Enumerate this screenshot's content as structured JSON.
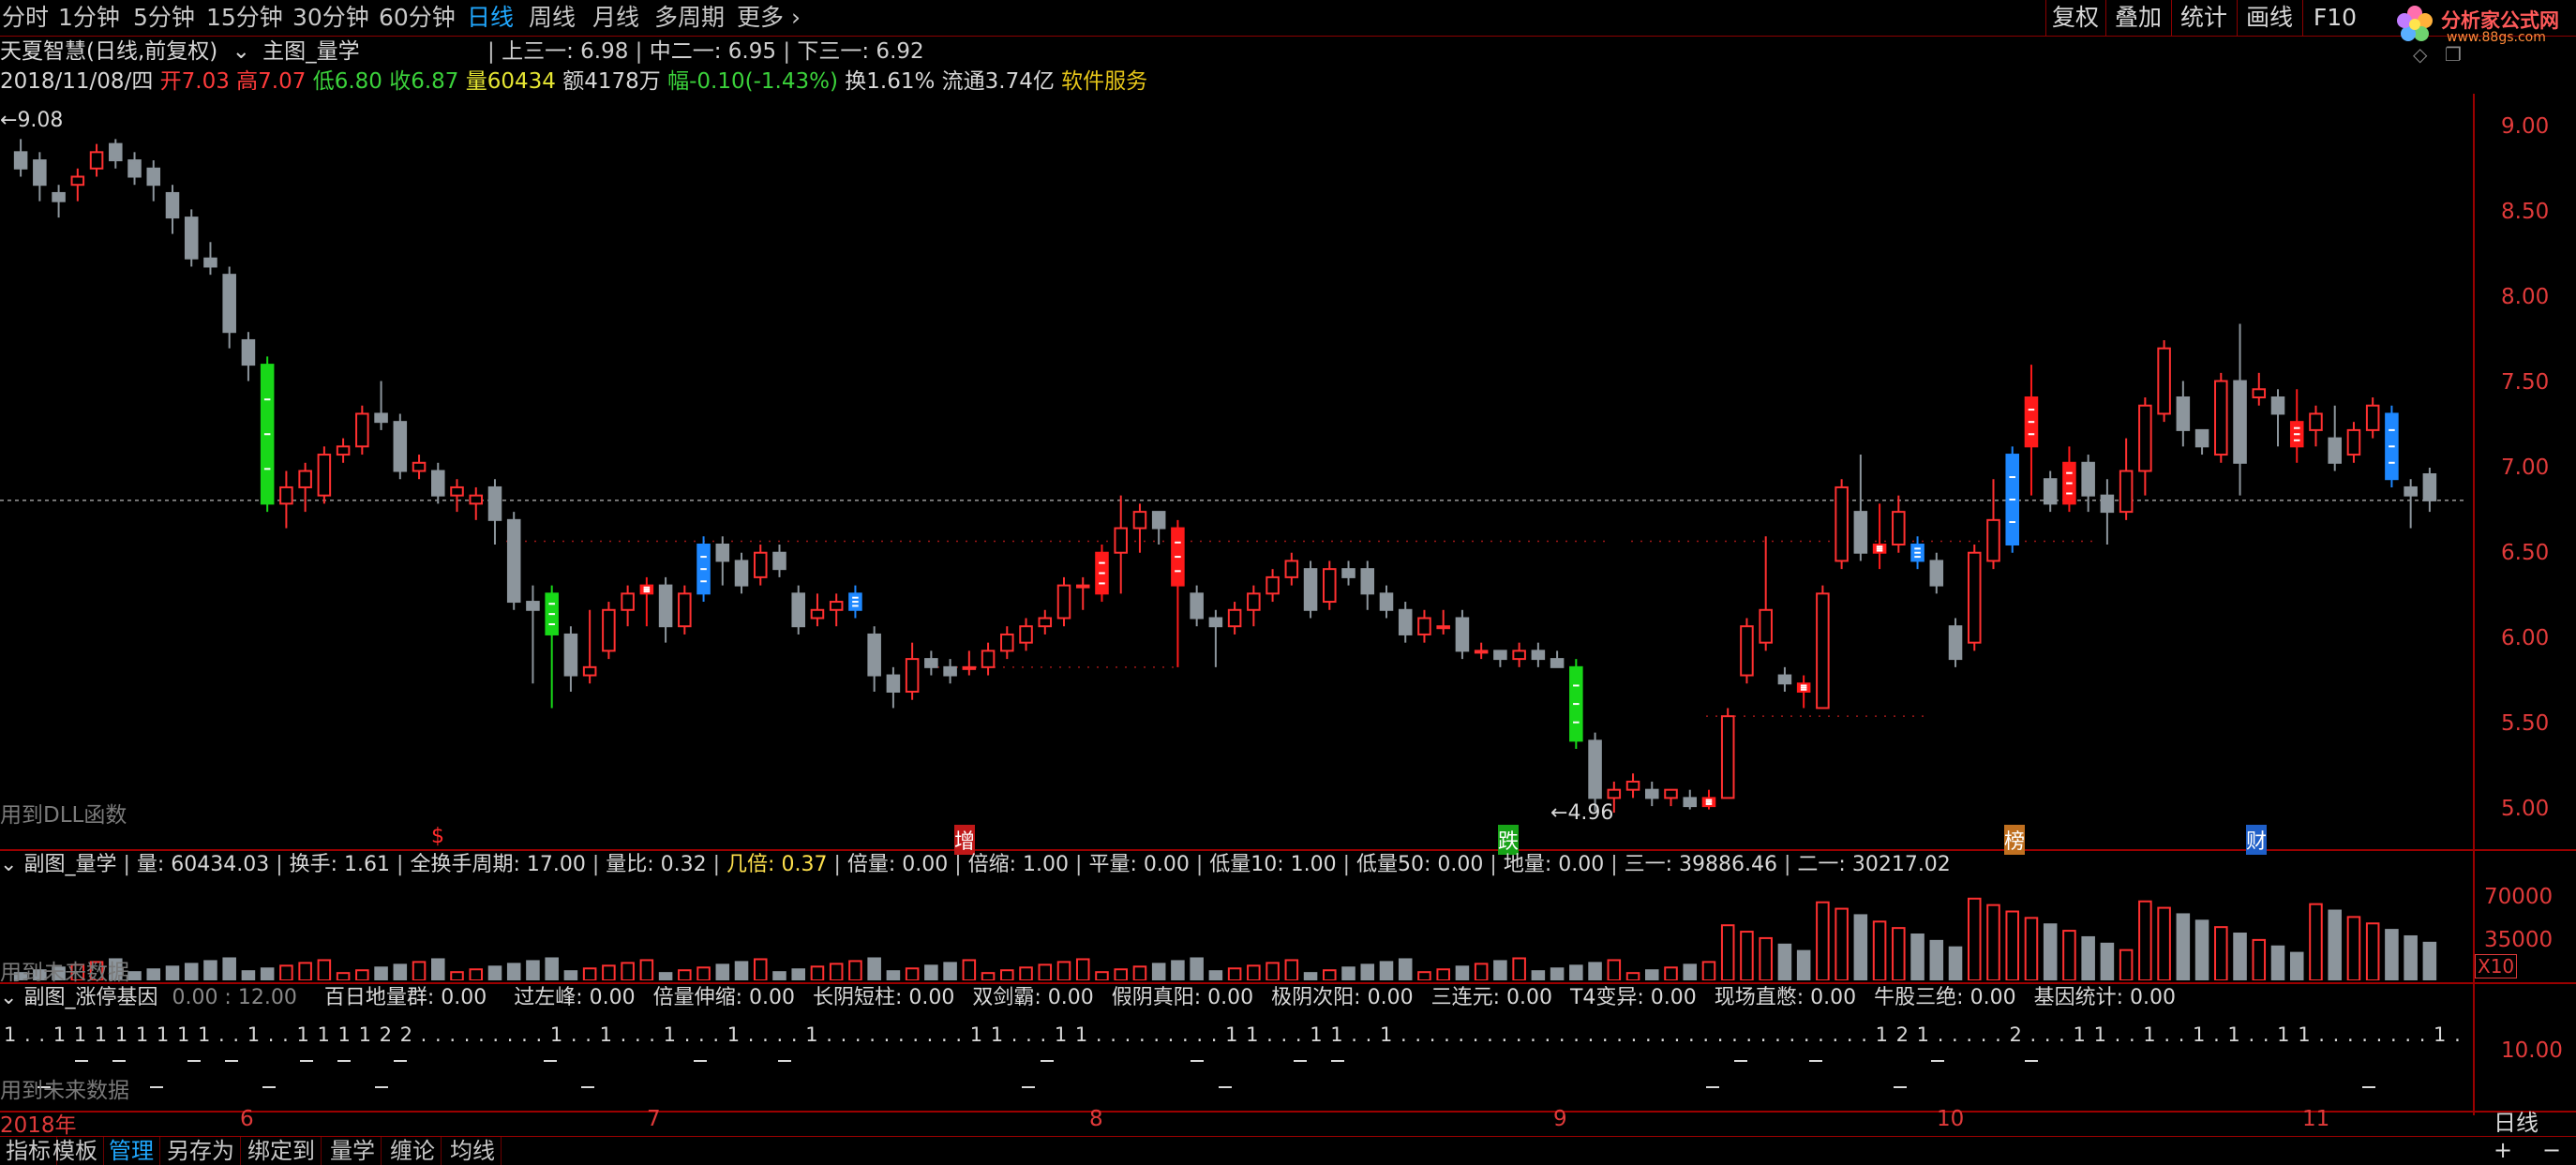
{
  "period_tabs": [
    "分时",
    "1分钟",
    "5分钟",
    "15分钟",
    "30分钟",
    "60分钟",
    "日线",
    "周线",
    "月线",
    "多周期",
    "更多"
  ],
  "active_period": "日线",
  "right_tools": [
    "复权",
    "叠加",
    "统计",
    "画线",
    "F10"
  ],
  "logo": {
    "name": "分析家公式网",
    "url_text": "www.88gs.com"
  },
  "title_row": {
    "stock": "天夏智慧(日线,前复权)",
    "main_indicator": "主图_量学",
    "upper": "上三一: 6.98",
    "middle": "中二一: 6.95",
    "lower": "下三一: 6.92"
  },
  "quote_row": {
    "date": "2018/11/08/四",
    "open_label": "开",
    "open": "7.03",
    "high_label": "高",
    "high": "7.07",
    "low_label": "低",
    "low": "6.80",
    "close_label": "收",
    "close": "6.87",
    "vol_label": "量",
    "vol": "60434",
    "amount": "额4178万",
    "change_label": "幅",
    "change": "-0.10(-1.43%)",
    "turnover": "换1.61%",
    "float_cap": "流通3.74亿",
    "service": "软件服务"
  },
  "main_chart": {
    "max_label": "9.08",
    "min_label": "4.96",
    "dll_note": "用到DLL函数",
    "yticks": [
      "9.00",
      "8.50",
      "8.00",
      "7.50",
      "7.00",
      "6.50",
      "6.00",
      "5.50",
      "5.00"
    ],
    "markers": [
      "$",
      "增",
      "跌",
      "榜",
      "财"
    ]
  },
  "sub1": {
    "title": "副图_量学",
    "fields": [
      "量: 60434.03",
      "换手: 1.61",
      "全换手周期: 17.00",
      "量比: 0.32",
      "几倍: 0.37",
      "倍量: 0.00",
      "倍缩: 1.00",
      "平量: 0.00",
      "低量10: 1.00",
      "低量50: 0.00",
      "地量: 0.00",
      "三一: 39886.46",
      "二一: 30217.02"
    ],
    "future_note": "用到未来数据",
    "yticks": [
      "70000",
      "35000"
    ],
    "unit": "X10"
  },
  "sub2": {
    "title": "副图_涨停基因",
    "values": "0.00 : 12.00",
    "fields": [
      "百日地量群: 0.00",
      "过左峰: 0.00",
      "倍量伸缩: 0.00",
      "长阴短柱: 0.00",
      "双剑霸: 0.00",
      "假阴真阳: 0.00",
      "极阴次阳: 0.00",
      "三连元: 0.00",
      "T4变异: 0.00",
      "现场直憋: 0.00",
      "牛股三绝: 0.00",
      "基因统计: 0.00"
    ],
    "future_note": "用到未来数据",
    "yticks": [
      "10.00"
    ],
    "row_text": "1 . . 1 1 1 1 1 1 1 1 . . 1 . . 1 1 1 1 2 2 . . . . . . . . . 1 . . 1 . . . 1 . . . 1 . . . . 1 . . . . . . . . . . 1 1 . . . 1 1 . . . . . . . . . 1 1 . . . 1 1 . . 1 . . . . . . . . . . . . . . . . . . . . . . . . . . . . . . . . . 1 2 1 . . . . . 2 . . . 1 1 . . 1 . . 1 . 1 . . 1 1 . . . . . . . . 1 . . 1 . . . . . . . . 1 1 . . . ."
  },
  "xaxis": [
    "2018年",
    "6",
    "7",
    "8",
    "9",
    "10",
    "11"
  ],
  "period_label": "日线",
  "bottom_tabs": [
    "指标",
    "模板",
    "管理",
    "另存为",
    "绑定到",
    "量学",
    "缠论",
    "均线"
  ],
  "active_bottom": "管理",
  "chart_data": {
    "type": "candlestick",
    "price_range": [
      4.8,
      9.3
    ],
    "reference_line": 6.87,
    "candles": [
      [
        9.0,
        8.9,
        9.08,
        8.85
      ],
      [
        8.95,
        8.8,
        9.0,
        8.7
      ],
      [
        8.75,
        8.7,
        8.8,
        8.6
      ],
      [
        8.8,
        8.85,
        8.9,
        8.7
      ],
      [
        8.9,
        9.0,
        9.05,
        8.85
      ],
      [
        9.05,
        8.95,
        9.08,
        8.9
      ],
      [
        8.95,
        8.85,
        9.0,
        8.8
      ],
      [
        8.9,
        8.8,
        8.95,
        8.7
      ],
      [
        8.75,
        8.6,
        8.8,
        8.5
      ],
      [
        8.6,
        8.35,
        8.65,
        8.3
      ],
      [
        8.35,
        8.3,
        8.45,
        8.25
      ],
      [
        8.25,
        7.9,
        8.3,
        7.8
      ],
      [
        7.85,
        7.7,
        7.9,
        7.6
      ],
      [
        7.7,
        6.85,
        7.75,
        6.8
      ],
      [
        6.85,
        6.95,
        7.05,
        6.7
      ],
      [
        6.95,
        7.05,
        7.1,
        6.8
      ],
      [
        6.9,
        7.15,
        7.2,
        6.85
      ],
      [
        7.15,
        7.2,
        7.25,
        7.1
      ],
      [
        7.2,
        7.4,
        7.45,
        7.15
      ],
      [
        7.4,
        7.35,
        7.6,
        7.3
      ],
      [
        7.35,
        7.05,
        7.4,
        7.0
      ],
      [
        7.05,
        7.1,
        7.15,
        7.0
      ],
      [
        7.05,
        6.9,
        7.1,
        6.85
      ],
      [
        6.9,
        6.95,
        7.0,
        6.8
      ],
      [
        6.85,
        6.9,
        6.95,
        6.75
      ],
      [
        6.95,
        6.75,
        7.0,
        6.6
      ],
      [
        6.75,
        6.25,
        6.8,
        6.2
      ],
      [
        6.25,
        6.2,
        6.35,
        5.75
      ],
      [
        6.3,
        6.05,
        6.35,
        5.6
      ],
      [
        6.05,
        5.8,
        6.1,
        5.7
      ],
      [
        5.8,
        5.85,
        6.2,
        5.75
      ],
      [
        5.95,
        6.2,
        6.25,
        5.9
      ],
      [
        6.2,
        6.3,
        6.35,
        6.1
      ],
      [
        6.3,
        6.35,
        6.4,
        6.1
      ],
      [
        6.35,
        6.1,
        6.4,
        6.0
      ],
      [
        6.1,
        6.3,
        6.35,
        6.05
      ],
      [
        6.3,
        6.6,
        6.65,
        6.25
      ],
      [
        6.6,
        6.5,
        6.65,
        6.35
      ],
      [
        6.5,
        6.35,
        6.55,
        6.3
      ],
      [
        6.4,
        6.55,
        6.6,
        6.35
      ],
      [
        6.55,
        6.45,
        6.6,
        6.4
      ],
      [
        6.3,
        6.1,
        6.35,
        6.05
      ],
      [
        6.15,
        6.2,
        6.3,
        6.1
      ],
      [
        6.2,
        6.25,
        6.3,
        6.1
      ],
      [
        6.2,
        6.3,
        6.35,
        6.15
      ],
      [
        6.05,
        5.8,
        6.1,
        5.7
      ],
      [
        5.8,
        5.7,
        5.85,
        5.6
      ],
      [
        5.7,
        5.9,
        6.0,
        5.65
      ],
      [
        5.9,
        5.85,
        5.95,
        5.8
      ],
      [
        5.85,
        5.8,
        5.9,
        5.75
      ],
      [
        5.85,
        5.85,
        5.95,
        5.8
      ],
      [
        5.85,
        5.95,
        6.0,
        5.8
      ],
      [
        5.95,
        6.05,
        6.1,
        5.9
      ],
      [
        6.0,
        6.1,
        6.15,
        5.95
      ],
      [
        6.1,
        6.15,
        6.2,
        6.05
      ],
      [
        6.15,
        6.35,
        6.4,
        6.1
      ],
      [
        6.35,
        6.35,
        6.4,
        6.2
      ],
      [
        6.3,
        6.55,
        6.6,
        6.25
      ],
      [
        6.55,
        6.7,
        6.9,
        6.3
      ],
      [
        6.7,
        6.8,
        6.85,
        6.55
      ],
      [
        6.8,
        6.7,
        6.8,
        6.6
      ],
      [
        6.7,
        6.35,
        6.75,
        5.85
      ],
      [
        6.3,
        6.15,
        6.35,
        6.1
      ],
      [
        6.15,
        6.1,
        6.2,
        5.85
      ],
      [
        6.1,
        6.2,
        6.25,
        6.05
      ],
      [
        6.2,
        6.3,
        6.35,
        6.1
      ],
      [
        6.3,
        6.4,
        6.45,
        6.25
      ],
      [
        6.4,
        6.5,
        6.55,
        6.35
      ],
      [
        6.45,
        6.2,
        6.5,
        6.15
      ],
      [
        6.25,
        6.45,
        6.5,
        6.2
      ],
      [
        6.45,
        6.4,
        6.5,
        6.35
      ],
      [
        6.45,
        6.3,
        6.5,
        6.2
      ],
      [
        6.3,
        6.2,
        6.35,
        6.15
      ],
      [
        6.2,
        6.05,
        6.25,
        6.0
      ],
      [
        6.05,
        6.15,
        6.2,
        6.0
      ],
      [
        6.1,
        6.1,
        6.2,
        6.05
      ],
      [
        6.15,
        5.95,
        6.2,
        5.9
      ],
      [
        5.95,
        5.95,
        6.0,
        5.9
      ],
      [
        5.95,
        5.9,
        5.95,
        5.85
      ],
      [
        5.9,
        5.95,
        6.0,
        5.85
      ],
      [
        5.95,
        5.9,
        6.0,
        5.85
      ],
      [
        5.9,
        5.85,
        5.95,
        5.85
      ],
      [
        5.85,
        5.4,
        5.9,
        5.35
      ],
      [
        5.4,
        5.05,
        5.45,
        4.97
      ],
      [
        5.05,
        5.1,
        5.15,
        4.96
      ],
      [
        5.1,
        5.15,
        5.2,
        5.05
      ],
      [
        5.1,
        5.05,
        5.15,
        5.0
      ],
      [
        5.05,
        5.1,
        5.1,
        5.0
      ],
      [
        5.05,
        5.0,
        5.1,
        4.98
      ],
      [
        5.0,
        5.05,
        5.1,
        4.98
      ],
      [
        5.05,
        5.55,
        5.6,
        5.05
      ],
      [
        5.8,
        6.1,
        6.15,
        5.75
      ],
      [
        6.0,
        6.2,
        6.65,
        5.95
      ],
      [
        5.8,
        5.75,
        5.85,
        5.7
      ],
      [
        5.75,
        5.7,
        5.8,
        5.6
      ],
      [
        5.6,
        6.3,
        6.35,
        5.6
      ],
      [
        6.5,
        6.95,
        7.0,
        6.45
      ],
      [
        6.8,
        6.55,
        7.15,
        6.5
      ],
      [
        6.55,
        6.6,
        6.85,
        6.45
      ],
      [
        6.6,
        6.8,
        6.9,
        6.55
      ],
      [
        6.6,
        6.5,
        6.65,
        6.45
      ],
      [
        6.5,
        6.35,
        6.55,
        6.3
      ],
      [
        6.1,
        5.9,
        6.15,
        5.85
      ],
      [
        6.0,
        6.55,
        6.6,
        5.95
      ],
      [
        6.5,
        6.75,
        7.0,
        6.45
      ],
      [
        6.6,
        7.15,
        7.2,
        6.55
      ],
      [
        7.2,
        7.5,
        7.7,
        6.9
      ],
      [
        7.0,
        6.85,
        7.05,
        6.8
      ],
      [
        6.85,
        7.1,
        7.2,
        6.8
      ],
      [
        7.1,
        6.9,
        7.15,
        6.8
      ],
      [
        6.9,
        6.8,
        7.0,
        6.6
      ],
      [
        6.8,
        7.05,
        7.25,
        6.75
      ],
      [
        7.05,
        7.45,
        7.5,
        6.9
      ],
      [
        7.4,
        7.8,
        7.85,
        7.35
      ],
      [
        7.5,
        7.3,
        7.6,
        7.2
      ],
      [
        7.3,
        7.2,
        7.3,
        7.15
      ],
      [
        7.15,
        7.6,
        7.65,
        7.1
      ],
      [
        7.6,
        7.1,
        7.95,
        6.9
      ],
      [
        7.5,
        7.55,
        7.65,
        7.45
      ],
      [
        7.5,
        7.4,
        7.55,
        7.2
      ],
      [
        7.35,
        7.2,
        7.55,
        7.1
      ],
      [
        7.3,
        7.4,
        7.45,
        7.2
      ],
      [
        7.25,
        7.1,
        7.45,
        7.05
      ],
      [
        7.15,
        7.3,
        7.35,
        7.1
      ],
      [
        7.3,
        7.45,
        7.5,
        7.25
      ],
      [
        7.4,
        7.0,
        7.45,
        6.95
      ],
      [
        6.95,
        6.9,
        7.0,
        6.7
      ],
      [
        7.03,
        6.87,
        7.07,
        6.8
      ]
    ],
    "highlight_candles": {
      "13": "green",
      "28": "green",
      "82": "green",
      "33": "red",
      "57": "red",
      "61": "red",
      "89": "red",
      "94": "red",
      "98": "red",
      "106": "red",
      "108": "red",
      "120": "red",
      "36": "blue",
      "44": "blue",
      "100": "blue",
      "105": "blue",
      "125": "blue"
    },
    "volume_max": 80000
  }
}
